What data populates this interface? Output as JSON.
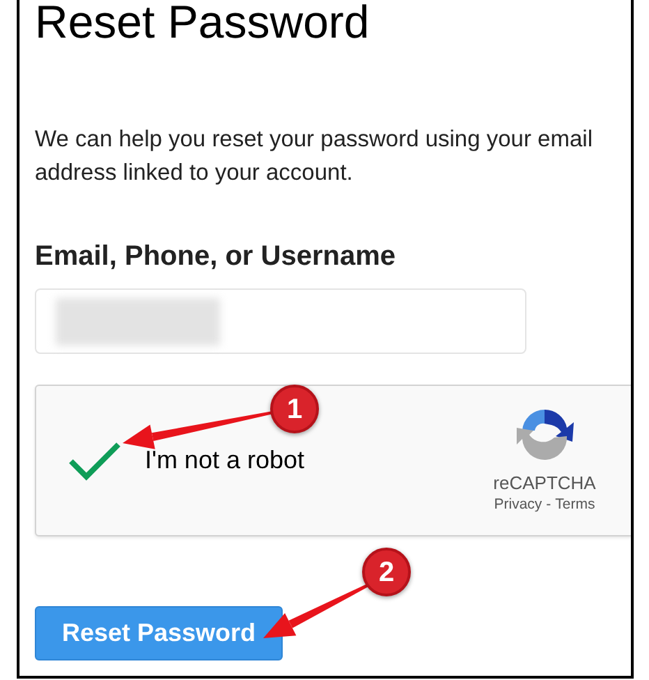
{
  "heading": "Reset Password",
  "description": "We can help you reset your password using your email address linked to your account.",
  "field": {
    "label": "Email, Phone, or Username",
    "redacted": true
  },
  "captcha": {
    "checked": true,
    "label": "I'm not a robot",
    "brand": "reCAPTCHA",
    "links": [
      "Privacy",
      "Terms"
    ],
    "separator": "-"
  },
  "button": {
    "label": "Reset Password"
  },
  "annotations": [
    {
      "label": "1"
    },
    {
      "label": "2"
    }
  ]
}
